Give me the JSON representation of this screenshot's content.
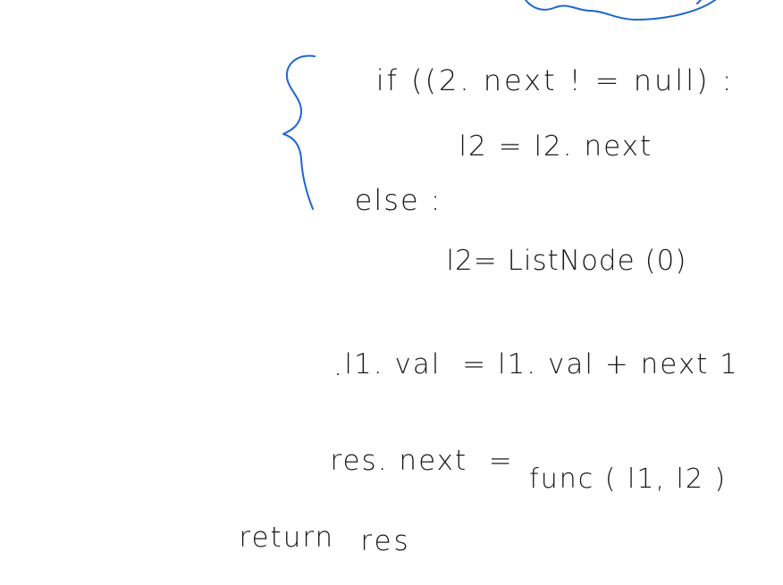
{
  "note": {
    "lines": {
      "if_line": "if ((2. next ! = null) :",
      "assign_next": "l2 = l2. next",
      "else_line": "else :",
      "assign_new": "l2= ListNode (0)",
      "val_line": "l1. val  = l1. val + next 1",
      "res_line": "res. next  =",
      "func_call": "func ( l1, l2 )",
      "return_kw": "return",
      "return_var": "res"
    },
    "annotation": {
      "color": "#1f66d1",
      "top_scribble": "loop-annotation-cutoff",
      "brace": "curly-brace-left"
    },
    "ink_color": "#1a1a1a",
    "background": "#ffffff"
  }
}
